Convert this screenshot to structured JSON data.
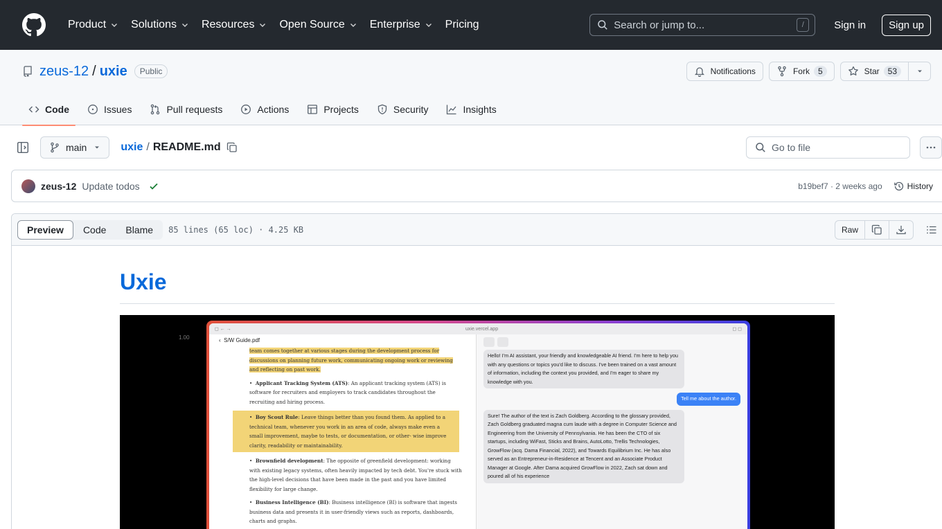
{
  "header": {
    "nav": [
      "Product",
      "Solutions",
      "Resources",
      "Open Source",
      "Enterprise",
      "Pricing"
    ],
    "search_placeholder": "Search or jump to...",
    "search_key": "/",
    "signin": "Sign in",
    "signup": "Sign up"
  },
  "repo": {
    "owner": "zeus-12",
    "separator": "/",
    "name": "uxie",
    "visibility": "Public",
    "notifications_label": "Notifications",
    "fork_label": "Fork",
    "fork_count": "5",
    "star_label": "Star",
    "star_count": "53",
    "tabs": [
      "Code",
      "Issues",
      "Pull requests",
      "Actions",
      "Projects",
      "Security",
      "Insights"
    ]
  },
  "file_bar": {
    "branch": "main",
    "repo_link": "uxie",
    "separator": "/",
    "file": "README.md",
    "goto_placeholder": "Go to file"
  },
  "commit": {
    "author": "zeus-12",
    "message": "Update todos",
    "meta": "b19bef7 · 2 weeks ago",
    "history": "History"
  },
  "viewer": {
    "modes": [
      "Preview",
      "Code",
      "Blame"
    ],
    "info": "85 lines (65 loc) · 4.25 KB",
    "raw": "Raw"
  },
  "readme": {
    "title": "Uxie"
  },
  "screenshot": {
    "zoom_label": "1.00",
    "url": "uxie.vercel.app",
    "pdf_title": "S/W Guide.pdf",
    "pdf_intro": "team comes together at various stages during the development process for discussions on planning future work, communicating ongoing work or reviewing and reflecting on past work.",
    "pdf_items": [
      {
        "term": "Applicant Tracking System (ATS)",
        "text": ": An applicant tracking system (ATS) is software for recruiters and employers to track candidates throughout the recruiting and hiring process."
      },
      {
        "term": "Boy Scout Rule",
        "text": ": Leave things better than you found them. As applied to a technical team, whenever you work in an area of code, always make even a small improvement, maybe to tests, or documentation, or other- wise improve clarity, readability or maintainability."
      },
      {
        "term": "Brownfield development",
        "text": ": The opposite of greenfield development: working with existing legacy systems, often heavily impacted by tech debt. You're stuck with the high-level decisions that have been made in the past and you have limited flexibility for large change."
      },
      {
        "term": "Business Intelligence (BI)",
        "text": ": Business intelligence (BI) is software that ingests business data and presents it in user-friendly views such as reports, dashboards, charts and graphs."
      }
    ],
    "chat": [
      {
        "role": "ai",
        "text": "Hello! I'm AI assistant, your friendly and knowledgeable AI friend. I'm here to help you with any questions or topics you'd like to discuss. I've been trained on a vast amount of information, including the context you provided, and I'm eager to share my knowledge with you."
      },
      {
        "role": "user",
        "text": "Tell me about the author."
      },
      {
        "role": "ai",
        "text": "Sure! The author of the text is Zach Goldberg. According to the glossary provided, Zach Goldberg graduated magna cum laude with a degree in Computer Science and Engineering from the University of Pennsylvania. He has been the CTO of six startups, including WiFast, Sticks and Brains, AutoLotto, Trellis Technologies, GrowFlow (acq. Dama Financial, 2022), and Towards Equilibrium Inc. He has also served as an Entrepreneur-in-Residence at Tencent and an Associate Product Manager at Google. After Dama acquired GrowFlow in 2022, Zach sat down and poured all of his experience"
      }
    ]
  },
  "colors": {
    "header_bg": "#24292f",
    "link": "#0969da",
    "tab_underline": "#fd8c73",
    "success": "#1a7f37"
  },
  "icons": [
    "github-logo-icon",
    "chevron-down-icon",
    "search-icon",
    "repo-icon",
    "bell-icon",
    "fork-icon",
    "star-icon",
    "code-icon",
    "issue-icon",
    "pull-request-icon",
    "play-icon",
    "table-icon",
    "shield-icon",
    "graph-icon",
    "sidebar-icon",
    "branch-icon",
    "copy-icon",
    "kebab-icon",
    "check-icon",
    "history-icon",
    "download-icon",
    "list-icon"
  ]
}
